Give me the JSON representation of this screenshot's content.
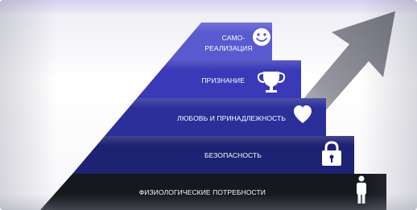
{
  "pyramid": {
    "levels": [
      {
        "label_lines": [
          "САМО-",
          "РЕАЛИЗАЦИЯ"
        ],
        "icon": "smiley-icon"
      },
      {
        "label_lines": [
          "ПРИЗНАНИЕ"
        ],
        "icon": "trophy-icon"
      },
      {
        "label_lines": [
          "ЛЮБОВЬ И ПРИНАДЛЕЖНОСТЬ"
        ],
        "icon": "heart-icon"
      },
      {
        "label_lines": [
          "БЕЗОПАСНОСТЬ"
        ],
        "icon": "lock-icon"
      },
      {
        "label_lines": [
          "ФИЗИОЛОГИЧЕСКИЕ ПОТРЕБНОСТИ"
        ],
        "icon": "person-icon"
      }
    ],
    "colors": {
      "level_1": "#5a5ad0",
      "level_2": "#3a3ab8",
      "level_3": "#2b2f9a",
      "level_4": "#1d2272",
      "level_5": "#15181d",
      "arrow": "#7b7b86"
    }
  }
}
